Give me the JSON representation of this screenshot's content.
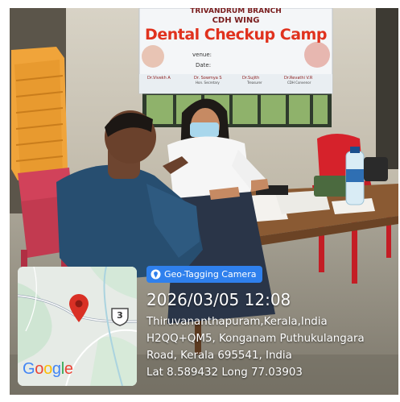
{
  "banner": {
    "branch": "TRIVANDRUM BRANCH",
    "wing": "CDH WING",
    "title": "Dental Checkup Camp",
    "venue_label": "venue:",
    "date_label": "Date:",
    "doctors": [
      {
        "name": "Dr.Vivekh A",
        "role": ""
      },
      {
        "name": "Dr. Sowmya S",
        "role": "Hon. Secretary"
      },
      {
        "name": "Dr.Sujith",
        "role": "Treasurer"
      },
      {
        "name": "Dr.Revathi V.R",
        "role": "CDH Convenor"
      }
    ]
  },
  "geotag": {
    "badge_label": "Geo-Tagging Camera",
    "timestamp": "2026/03/05 12:08",
    "location_lines": [
      "Thiruvananthapuram,Kerala,India",
      "H2QQ+QM5, Konganam Puthukulangara",
      "Road, Kerala 695541, India",
      "Lat 8.589432 Long 77.03903"
    ]
  },
  "map": {
    "road_shield": "3",
    "logo_text": "Google",
    "logo_colors": [
      "#4285F4",
      "#EA4335",
      "#FBBC05",
      "#4285F4",
      "#34A853",
      "#EA4335"
    ]
  },
  "colors": {
    "badge": "#2f80ed",
    "pin": "#d93025",
    "banner_title": "#e0321e"
  }
}
